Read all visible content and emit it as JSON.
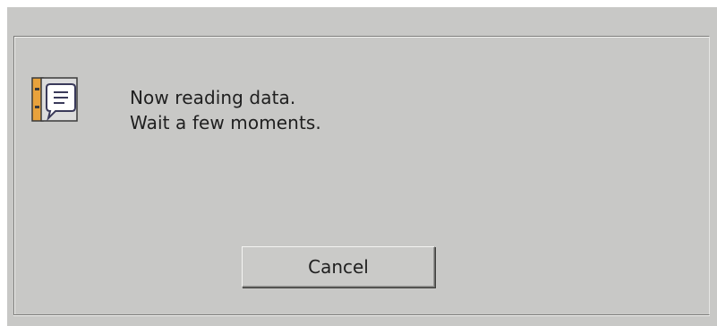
{
  "dialog": {
    "message_line1": "Now reading data.",
    "message_line2": "Wait a few moments.",
    "icon": "reading-data-icon",
    "cancel_label": "Cancel"
  },
  "colors": {
    "dialog_bg": "#c8c8c6",
    "text": "#1f1f1f",
    "icon_orange": "#e8a23c",
    "icon_dark": "#3a3a5a"
  }
}
